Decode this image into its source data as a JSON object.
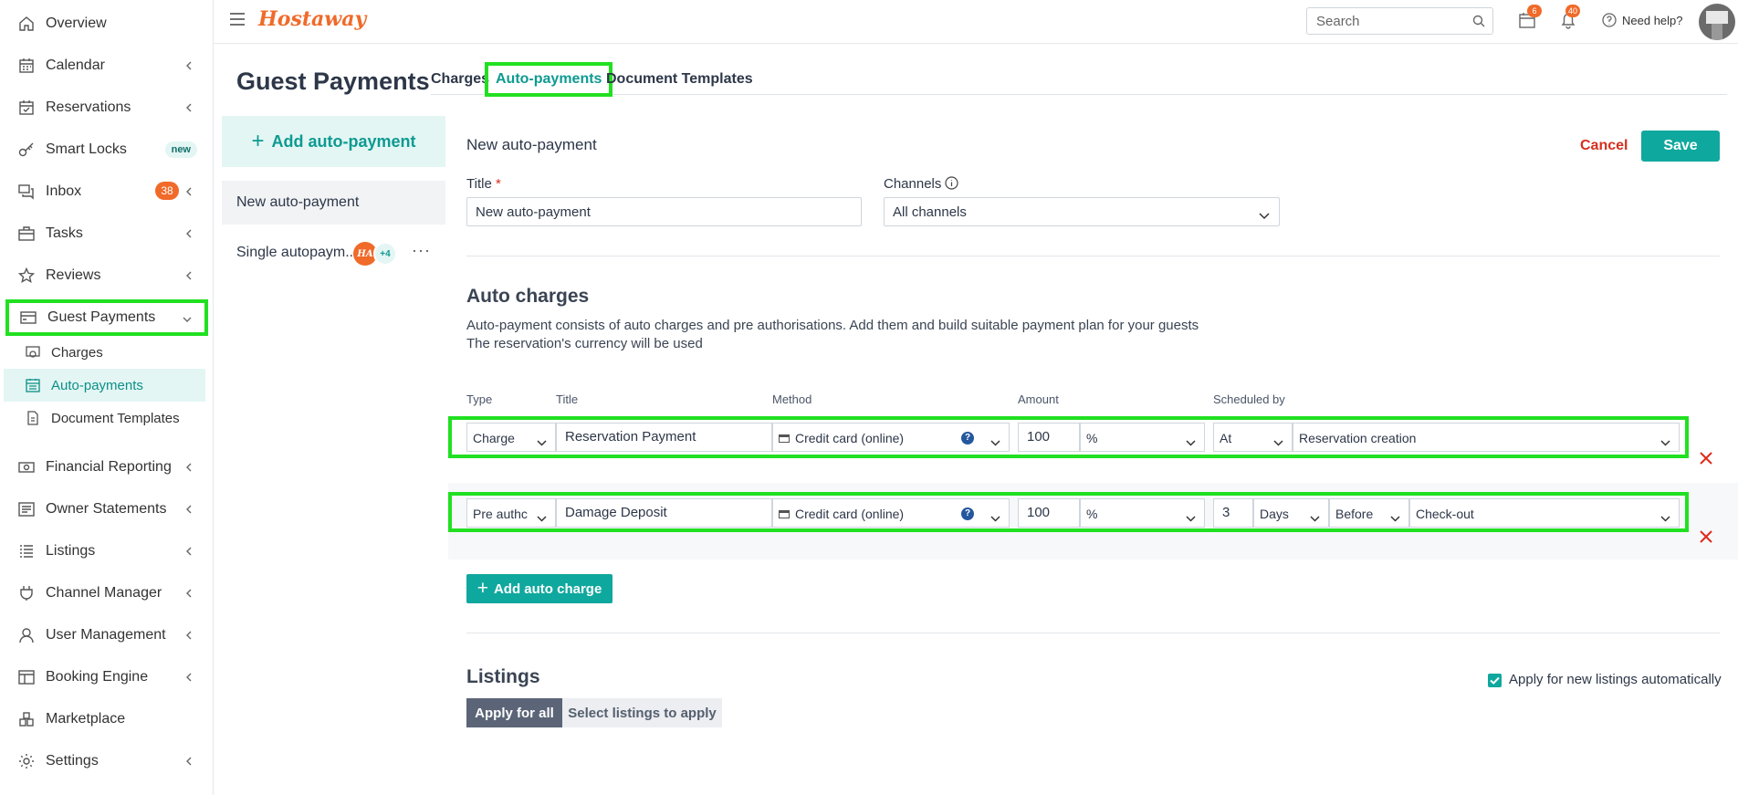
{
  "header": {
    "logo": "Hostaway",
    "search_placeholder": "Search",
    "calendar_badge": "6",
    "notifications_badge": "40",
    "help_label": "Need help?"
  },
  "sidebar": {
    "items": [
      {
        "label": "Overview"
      },
      {
        "label": "Calendar"
      },
      {
        "label": "Reservations"
      },
      {
        "label": "Smart Locks",
        "badge": "new"
      },
      {
        "label": "Inbox",
        "badge": "38"
      },
      {
        "label": "Tasks"
      },
      {
        "label": "Reviews"
      },
      {
        "label": "Guest Payments"
      },
      {
        "label": "Financial Reporting"
      },
      {
        "label": "Owner Statements"
      },
      {
        "label": "Listings"
      },
      {
        "label": "Channel Manager"
      },
      {
        "label": "User Management"
      },
      {
        "label": "Booking Engine"
      },
      {
        "label": "Marketplace"
      },
      {
        "label": "Settings"
      }
    ],
    "sub_items": [
      {
        "label": "Charges"
      },
      {
        "label": "Auto-payments"
      },
      {
        "label": "Document Templates"
      }
    ]
  },
  "page": {
    "title": "Guest Payments",
    "tabs": [
      {
        "label": "Charges"
      },
      {
        "label": "Auto-payments"
      },
      {
        "label": "Document Templates"
      }
    ]
  },
  "left_panel": {
    "add_button": "Add auto-payment",
    "items": [
      {
        "label": "New auto-payment"
      },
      {
        "label": "Single autopaym..."
      }
    ],
    "chip_a": "HA",
    "chip_b": "+4",
    "more": "···"
  },
  "form": {
    "heading": "New auto-payment",
    "cancel": "Cancel",
    "save": "Save",
    "title_label": "Title",
    "title_required": "*",
    "title_value": "New auto-payment",
    "channels_label": "Channels",
    "channels_value": "All channels"
  },
  "auto_charges": {
    "heading": "Auto charges",
    "desc_line1": "Auto-payment consists of auto charges and pre authorisations. Add them and build suitable payment plan for your guests",
    "desc_line2": "The reservation's currency will be used",
    "columns": {
      "type": "Type",
      "title": "Title",
      "method": "Method",
      "amount": "Amount",
      "scheduled": "Scheduled by"
    },
    "rows": [
      {
        "type": "Charge",
        "title": "Reservation Payment",
        "method": "Credit card (online)",
        "amount": "100",
        "unit": "%",
        "when": "At",
        "event": "Reservation creation"
      },
      {
        "type": "Pre authc",
        "title": "Damage Deposit",
        "method": "Credit card (online)",
        "amount": "100",
        "unit": "%",
        "days_value": "3",
        "days_unit": "Days",
        "relation": "Before",
        "event": "Check-out"
      }
    ],
    "add_button": "Add auto charge"
  },
  "listings": {
    "heading": "Listings",
    "apply_all": "Apply for all",
    "select": "Select listings to apply",
    "auto_apply_label": "Apply for new listings automatically"
  },
  "colors": {
    "accent": "#0fa89e",
    "brand": "#f06a2a",
    "highlight": "#21e021",
    "danger": "#d62f1e"
  }
}
